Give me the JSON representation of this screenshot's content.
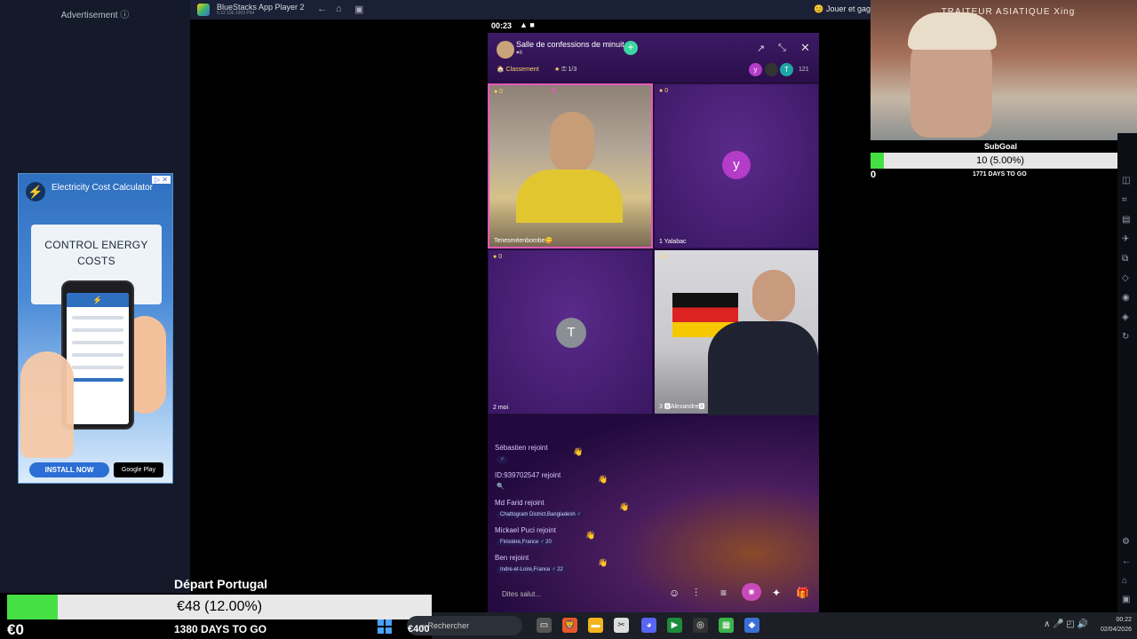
{
  "ad": {
    "label": "Advertisement ⓘ",
    "badge": "▷ ✕",
    "title": "Electricity Cost Calculator",
    "headline": "CONTROL ENERGY COSTS",
    "install": "INSTALL NOW",
    "gplay": "Google Play"
  },
  "bluestacks": {
    "title": "BlueStacks App Player 2",
    "version": "5.22.106.1003 P64",
    "play": "Jouer et gag"
  },
  "phone": {
    "clock": "00:23",
    "room_name": "Salle de confessions de minuit",
    "room_likes": "♥8",
    "ranking": "Classement",
    "stars": "1/3",
    "viewer_count": "121",
    "viewers": [
      "y",
      "",
      "T"
    ],
    "tiles": [
      {
        "badge": "0",
        "name": "Tenesméenbombe😋"
      },
      {
        "badge": "0",
        "name": "1   Yalabac",
        "avatar": "y"
      },
      {
        "badge": "0",
        "name": "2   moi",
        "avatar": "T"
      },
      {
        "badge": "0",
        "name": "3   🅰Alexandre🅰"
      }
    ],
    "chat": [
      {
        "text": "Sébastien rejoint",
        "sub": "♂"
      },
      {
        "text": "ID:939702547 rejoint",
        "sub": ""
      },
      {
        "text": "Md Farid rejoint",
        "sub": "Chattogram District,Bangladesh  ♂"
      },
      {
        "text": "Mickael Puci rejoint",
        "sub": "Finistère,France  ♂ 20"
      },
      {
        "text": "Ben rejoint",
        "sub": "Indre-et-Loire,France  ♂ 22"
      }
    ],
    "input_placeholder": "Dites salut..."
  },
  "webcam": {
    "sign": "TRAITEUR ASIATIQUE Xing"
  },
  "subgoal": {
    "title": "SubGoal",
    "text": "10 (5.00%)",
    "fill": 0.05,
    "zero": "0",
    "days": "1771 DAYS TO GO",
    "max": "200"
  },
  "donation": {
    "title": "Départ Portugal",
    "text": "€48 (12.00%)",
    "fill": 0.12,
    "zero": "€0",
    "days": "1380 DAYS TO GO",
    "max": "€400"
  },
  "taskbar": {
    "search": "Rechercher",
    "time": "00:22",
    "date": "02/04/2026"
  },
  "colors": {
    "accent": "#44e044",
    "brand": "#3a6fd8"
  }
}
